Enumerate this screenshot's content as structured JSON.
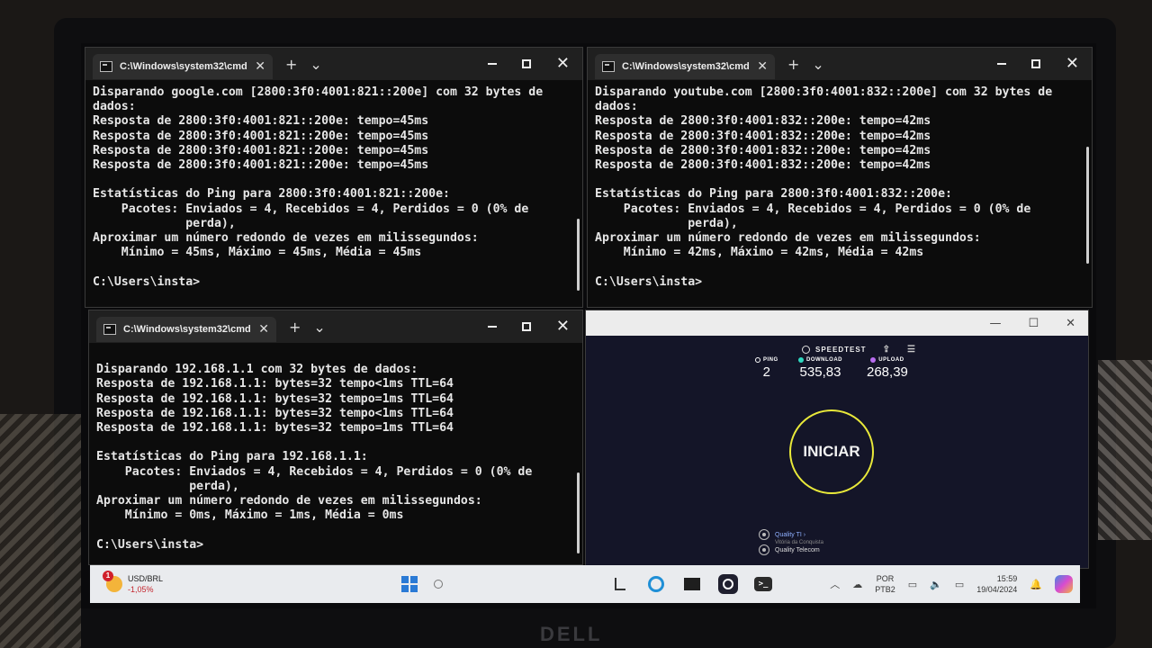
{
  "terminals": [
    {
      "title": "C:\\Windows\\system32\\cmd.e",
      "lines": [
        "Disparando google.com [2800:3f0:4001:821::200e] com 32 bytes de",
        "dados:",
        "Resposta de 2800:3f0:4001:821::200e: tempo=45ms",
        "Resposta de 2800:3f0:4001:821::200e: tempo=45ms",
        "Resposta de 2800:3f0:4001:821::200e: tempo=45ms",
        "Resposta de 2800:3f0:4001:821::200e: tempo=45ms",
        "",
        "Estatísticas do Ping para 2800:3f0:4001:821::200e:",
        "    Pacotes: Enviados = 4, Recebidos = 4, Perdidos = 0 (0% de",
        "             perda),",
        "Aproximar um número redondo de vezes em milissegundos:",
        "    Mínimo = 45ms, Máximo = 45ms, Média = 45ms",
        "",
        "C:\\Users\\insta>"
      ]
    },
    {
      "title": "C:\\Windows\\system32\\cmd.e",
      "lines": [
        "Disparando youtube.com [2800:3f0:4001:832::200e] com 32 bytes de",
        "dados:",
        "Resposta de 2800:3f0:4001:832::200e: tempo=42ms",
        "Resposta de 2800:3f0:4001:832::200e: tempo=42ms",
        "Resposta de 2800:3f0:4001:832::200e: tempo=42ms",
        "Resposta de 2800:3f0:4001:832::200e: tempo=42ms",
        "",
        "Estatísticas do Ping para 2800:3f0:4001:832::200e:",
        "    Pacotes: Enviados = 4, Recebidos = 4, Perdidos = 0 (0% de",
        "             perda),",
        "Aproximar um número redondo de vezes em milissegundos:",
        "    Mínimo = 42ms, Máximo = 42ms, Média = 42ms",
        "",
        "C:\\Users\\insta>"
      ]
    },
    {
      "title": "C:\\Windows\\system32\\cmd.e",
      "lines": [
        "",
        "Disparando 192.168.1.1 com 32 bytes de dados:",
        "Resposta de 192.168.1.1: bytes=32 tempo<1ms TTL=64",
        "Resposta de 192.168.1.1: bytes=32 tempo=1ms TTL=64",
        "Resposta de 192.168.1.1: bytes=32 tempo<1ms TTL=64",
        "Resposta de 192.168.1.1: bytes=32 tempo=1ms TTL=64",
        "",
        "Estatísticas do Ping para 192.168.1.1:",
        "    Pacotes: Enviados = 4, Recebidos = 4, Perdidos = 0 (0% de",
        "             perda),",
        "Aproximar um número redondo de vezes em milissegundos:",
        "    Mínimo = 0ms, Máximo = 1ms, Média = 0ms",
        "",
        "C:\\Users\\insta>"
      ]
    }
  ],
  "speedtest": {
    "brand": "SPEEDTEST",
    "ping": {
      "label": "PING",
      "value": "2"
    },
    "download": {
      "label": "DOWNLOAD",
      "value": "535,83"
    },
    "upload": {
      "label": "UPLOAD",
      "value": "268,39"
    },
    "go_label": "INICIAR",
    "provider_1": {
      "name": "Quality TI ›",
      "sub": "Vitória da Conquista"
    },
    "provider_2": {
      "name": "Quality Telecom"
    },
    "colors": {
      "download": "#2fd8c0",
      "upload": "#b86cf0",
      "button_ring": "#e9e93a"
    }
  },
  "taskbar": {
    "widget": {
      "badge": "1",
      "label": "USD/BRL",
      "delta": "-1,05%"
    },
    "language": {
      "line1": "POR",
      "line2": "PTB2"
    },
    "clock": {
      "time": "15:59",
      "date": "19/04/2024"
    }
  },
  "device": {
    "brand": "DELL"
  }
}
